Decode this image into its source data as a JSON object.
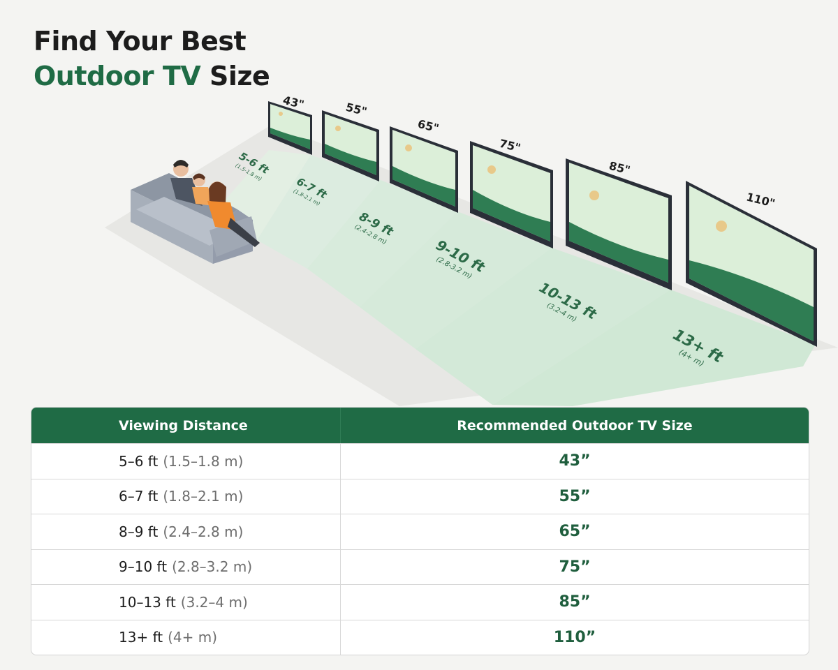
{
  "title": {
    "line1": "Find Your Best",
    "line2_accent": "Outdoor TV",
    "line2_rest": "Size"
  },
  "illustration": {
    "tvs": [
      {
        "size": "43\"",
        "distance": "5-6 ft",
        "metric": "(1.5-1.8 m)"
      },
      {
        "size": "55\"",
        "distance": "6-7 ft",
        "metric": "(1.8-2.1 m)"
      },
      {
        "size": "65\"",
        "distance": "8-9 ft",
        "metric": "(2.4-2.8 m)"
      },
      {
        "size": "75\"",
        "distance": "9-10 ft",
        "metric": "(2.8-3.2 m)"
      },
      {
        "size": "85\"",
        "distance": "10-13 ft",
        "metric": "(3.2-4 m)"
      },
      {
        "size": "110\"",
        "distance": "13+ ft",
        "metric": "(4+ m)"
      }
    ]
  },
  "table": {
    "headers": [
      "Viewing Distance",
      "Recommended Outdoor TV Size"
    ],
    "rows": [
      {
        "feet": "5–6 ft",
        "metric": "(1.5–1.8 m)",
        "size": "43”"
      },
      {
        "feet": "6–7 ft",
        "metric": "(1.8–2.1 m)",
        "size": "55”"
      },
      {
        "feet": "8–9 ft",
        "metric": "(2.4–2.8 m)",
        "size": "65”"
      },
      {
        "feet": "9–10 ft",
        "metric": "(2.8–3.2 m)",
        "size": "75”"
      },
      {
        "feet": "10–13 ft",
        "metric": "(3.2–4 m)",
        "size": "85”"
      },
      {
        "feet": "13+ ft",
        "metric": "(4+ m)",
        "size": "110”"
      }
    ]
  },
  "colors": {
    "brand_green": "#1f6b45",
    "zone_green": "#dcefdf",
    "screen_green": "#2f7d53",
    "frame": "#2a2f38"
  }
}
